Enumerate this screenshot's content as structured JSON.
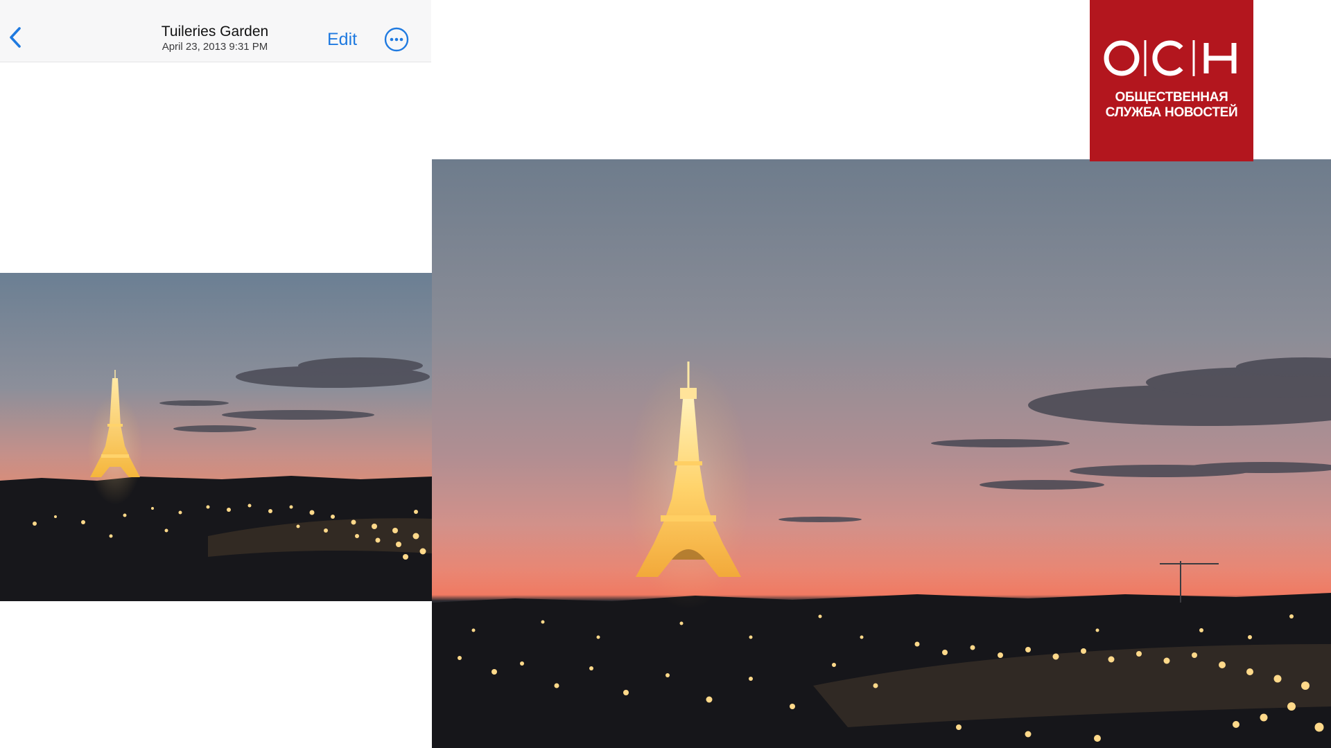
{
  "nav": {
    "title": "Tuileries Garden",
    "subtitle": "April 23, 2013  9:31 PM",
    "edit_label": "Edit",
    "back_icon": "chevron-left-icon",
    "more_icon": "ellipsis-circle-icon",
    "accent_color": "#1f7ae0"
  },
  "photo": {
    "subject": "Eiffel Tower at dusk over Paris"
  },
  "logo": {
    "mark": "ОСН",
    "line1": "ОБЩЕСТВЕННАЯ",
    "line2": "СЛУЖБА НОВОСТЕЙ",
    "background_color": "#b3161e"
  }
}
